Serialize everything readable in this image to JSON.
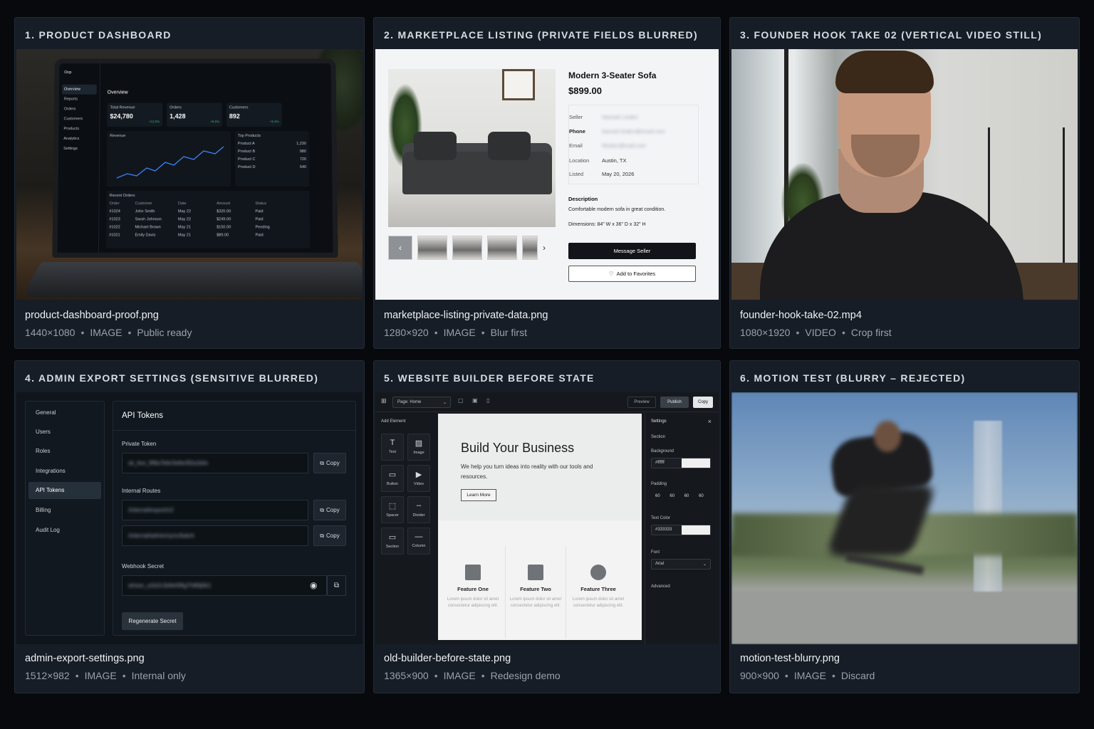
{
  "cards": [
    {
      "title": "1. PRODUCT DASHBOARD",
      "filename": "product-dashboard-proof.png",
      "dimensions": "1440×1080",
      "type": "IMAGE",
      "status": "Public ready",
      "preview": {
        "brand": "Ocp",
        "section_title": "Overview",
        "nav": [
          "Overview",
          "Reports",
          "Orders",
          "Customers",
          "Products",
          "Analytics",
          "Settings"
        ],
        "kpis": [
          {
            "label": "Total Revenue",
            "value": "$24,780",
            "delta": "+12.5%"
          },
          {
            "label": "Orders",
            "value": "1,428",
            "delta": "+8.6%"
          },
          {
            "label": "Customers",
            "value": "892",
            "delta": "+5.4%"
          }
        ],
        "revenue_label": "Revenue",
        "top_products_label": "Top Products",
        "top_products": [
          {
            "name": "Product A",
            "value": "1,230"
          },
          {
            "name": "Product B",
            "value": "980"
          },
          {
            "name": "Product C",
            "value": "720"
          },
          {
            "name": "Product D",
            "value": "540"
          }
        ],
        "recent_orders_label": "Recent Orders",
        "orders_columns": [
          "Order",
          "Customer",
          "Date",
          "Amount",
          "Status"
        ],
        "orders": [
          [
            "#1024",
            "John Smith",
            "May 22",
            "$320.00",
            "Paid"
          ],
          [
            "#1023",
            "Sarah Johnson",
            "May 22",
            "$249.00",
            "Paid"
          ],
          [
            "#1022",
            "Michael Brown",
            "May 21",
            "$150.00",
            "Pending"
          ],
          [
            "#1021",
            "Emily Davis",
            "May 21",
            "$89.00",
            "Paid"
          ]
        ]
      }
    },
    {
      "title": "2. MARKETPLACE LISTING (PRIVATE FIELDS BLURRED)",
      "filename": "marketplace-listing-private-data.png",
      "dimensions": "1280×920",
      "type": "IMAGE",
      "status": "Blur first",
      "preview": {
        "item_title": "Modern 3-Seater Sofa",
        "price": "$899.00",
        "fields": [
          {
            "label": "Seller",
            "value": "Hannah Linden",
            "blurred": true
          },
          {
            "label": "Phone",
            "value": "hannah.linden@email.com",
            "blurred": true
          },
          {
            "label": "Email",
            "value": "hlinden@mail.com",
            "blurred": true
          },
          {
            "label": "Location",
            "value": "Austin, TX",
            "blurred": false
          },
          {
            "label": "Listed",
            "value": "May 20, 2026",
            "blurred": false
          }
        ],
        "description_label": "Description",
        "description": "Comfortable modern sofa in great condition.",
        "dimensions_text": "Dimensions: 84\" W x 36\" D x 32\" H",
        "message_button": "Message Seller",
        "favorites_button": "Add to Favorites"
      }
    },
    {
      "title": "3. FOUNDER HOOK TAKE 02 (VERTICAL VIDEO STILL)",
      "filename": "founder-hook-take-02.mp4",
      "dimensions": "1080×1920",
      "type": "VIDEO",
      "status": "Crop first"
    },
    {
      "title": "4. ADMIN EXPORT SETTINGS (SENSITIVE BLURRED)",
      "filename": "admin-export-settings.png",
      "dimensions": "1512×982",
      "type": "IMAGE",
      "status": "Internal only",
      "preview": {
        "nav": [
          "General",
          "Users",
          "Roles",
          "Integrations",
          "API Tokens",
          "Billing",
          "Audit Log"
        ],
        "active_nav": "API Tokens",
        "heading": "API Tokens",
        "private_token_label": "Private Token",
        "private_token_value": "sk_live_9f8a7b6c5d4e3f2a1b0c",
        "internal_routes_label": "Internal Routes",
        "internal_route_1": "/internal/export/v2",
        "internal_route_2": "/internal/admin/sync/batch",
        "webhook_label": "Webhook Secret",
        "webhook_value": "whsec_a1b2c3d4e5f6g7h8i9j0k1",
        "copy_label": "Copy",
        "regen_label": "Regenerate Secret"
      }
    },
    {
      "title": "5. WEBSITE BUILDER BEFORE STATE",
      "filename": "old-builder-before-state.png",
      "dimensions": "1365×900",
      "type": "IMAGE",
      "status": "Redesign demo",
      "preview": {
        "page_select": "Page: Home",
        "preview_btn": "Preview",
        "publish_btn": "Publish",
        "copy_btn": "Copy",
        "add_element_label": "Add Element",
        "elements": [
          "Text",
          "Image",
          "Button",
          "Video",
          "Spacer",
          "Divider",
          "Section",
          "Column"
        ],
        "hero_title": "Build Your Business",
        "hero_text": "We help you turn ideas into reality with our tools and resources.",
        "hero_button": "Learn More",
        "features": [
          "Feature One",
          "Feature Two",
          "Feature Three"
        ],
        "feature_text": "Lorem ipsum dolor sit amet consectetur adipiscing elit.",
        "settings_label": "Settings",
        "section_label": "Section",
        "background_label": "Background",
        "background_value": "#ffffff",
        "padding_label": "Padding",
        "padding_values": [
          "60",
          "60",
          "60",
          "60"
        ],
        "text_color_label": "Text Color",
        "text_color_value": "#333333",
        "font_label": "Font",
        "font_value": "Arial",
        "advanced_label": "Advanced"
      }
    },
    {
      "title": "6. MOTION TEST (BLURRY – REJECTED)",
      "filename": "motion-test-blurry.png",
      "dimensions": "900×900",
      "type": "IMAGE",
      "status": "Discard"
    }
  ],
  "colors": {
    "page_bg": "#07090c",
    "card_bg": "#171d26",
    "accent_green": "#3fb87a"
  }
}
